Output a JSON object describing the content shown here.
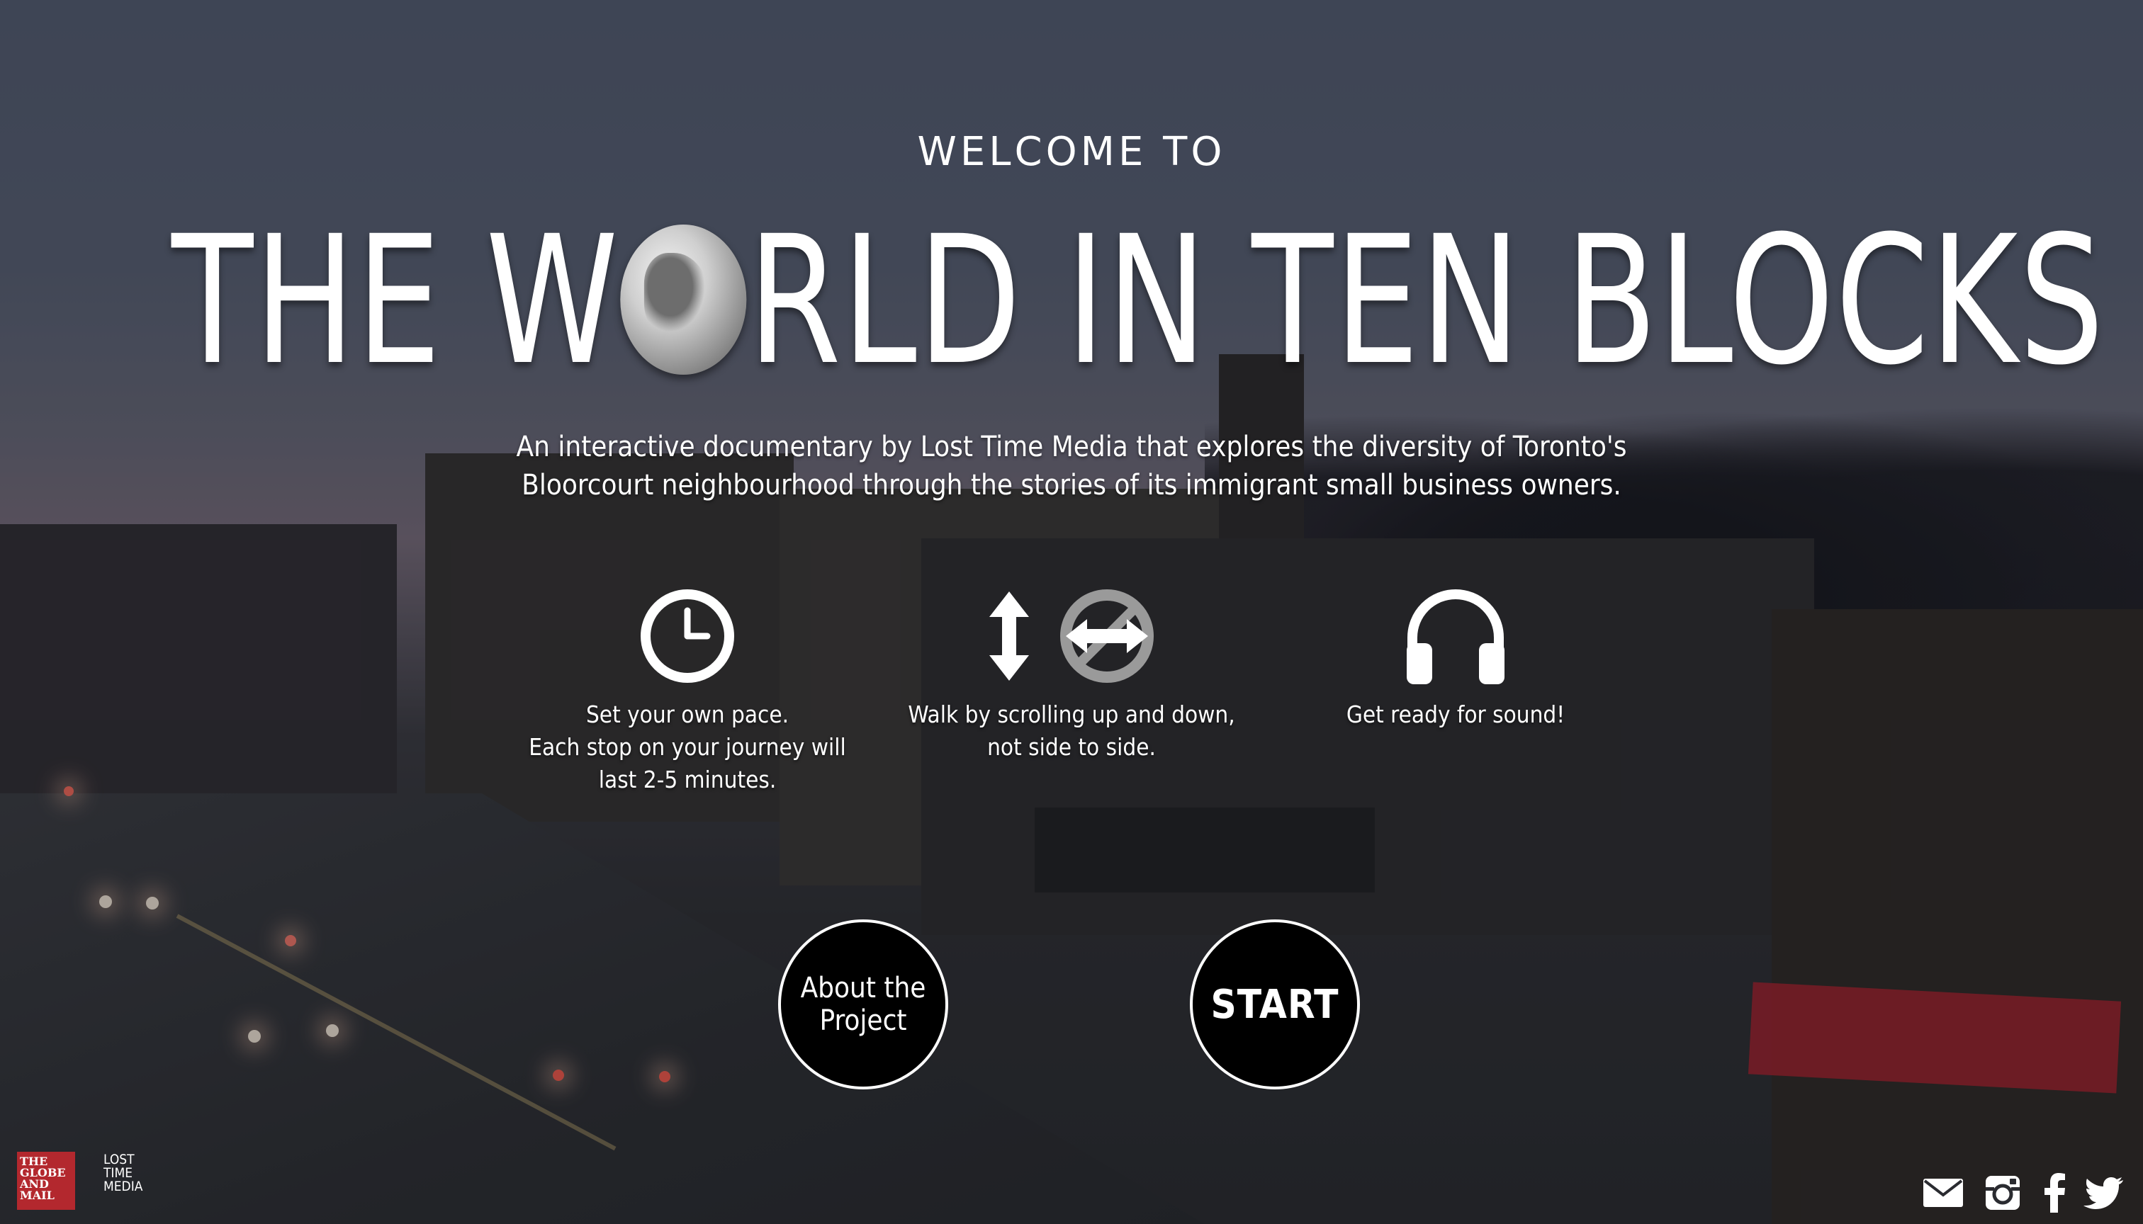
{
  "header": {
    "welcome": "WELCOME TO",
    "title_part1": "THE W",
    "title_part2": "RLD IN TEN BLOCKS"
  },
  "description": {
    "line1": "An interactive documentary by Lost Time Media that explores the diversity of Toronto's",
    "line2": "Bloorcourt neighbourhood through the stories of its immigrant small business owners."
  },
  "features": {
    "pace": {
      "line1": "Set your own pace.",
      "line2": "Each stop on your journey will",
      "line3": "last 2-5 minutes.",
      "icon": "clock-icon"
    },
    "scroll": {
      "line1": "Walk by scrolling up and down,",
      "line2": "not side to side.",
      "icons": [
        "vertical-arrow-icon",
        "no-horizontal-scroll-icon"
      ]
    },
    "sound": {
      "line1": "Get ready for sound!",
      "icon": "headphones-icon"
    }
  },
  "buttons": {
    "about_line1": "About the",
    "about_line2": "Project",
    "start": "START"
  },
  "logos": {
    "globe_and_mail": [
      "THE",
      "GLOBE",
      "AND",
      "MAIL"
    ],
    "lost_time_media": [
      "LOST",
      "TIME",
      "MEDIA"
    ]
  },
  "social": [
    "email-icon",
    "instagram-icon",
    "facebook-icon",
    "twitter-icon"
  ],
  "colors": {
    "text": "#ffffff",
    "button_bg": "#000000",
    "globe_and_mail_red": "#b3282e"
  }
}
